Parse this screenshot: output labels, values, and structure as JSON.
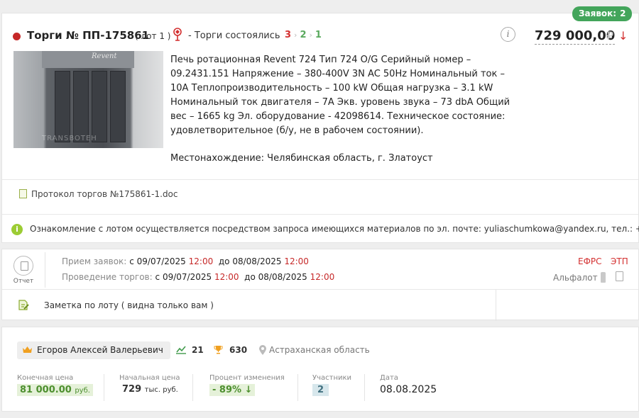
{
  "bids_badge": {
    "label": "Заявок:",
    "count": "2"
  },
  "header": {
    "title": "Торги № ПП-175861",
    "lot": "( лот 1 )",
    "status": "- Торги состоялись",
    "steps": [
      "3",
      "2",
      "1"
    ],
    "price": "729 000,00",
    "currency": "₽",
    "price_trend": "↓",
    "status_color": "#c62828"
  },
  "lot": {
    "photo_brand": "Revent",
    "photo_watermark": "TRANSBOTEH",
    "description": "Печь ротационная Revent 724 Тип 724 O/G Серийный номер – 09.2431.151 Напряжение – 380-400V 3N AC 50Hz Номинальный ток – 10A Теплопроизводительность – 100 kW Общая нагрузка – 3.1 kW Номинальный ток двигателя – 7А Экв. уровень звука – 73 dbA Общий вес – 1665 kg Эл. оборудование - 42098614. Техническое состояние: удовлетворительное (б/у, не в рабочем состоянии).",
    "location": "Местонахождение: Челябинская область, г. Златоуст"
  },
  "document": {
    "name": "Протокол торгов №175861-1.doc"
  },
  "notice": {
    "text": "Ознакомление с лотом осуществляется посредством запроса имеющихся материалов по эл. почте: yuliaschumkowa@yandex.ru, тел.: +…"
  },
  "schedule": {
    "report_label": "Отчет",
    "bids": {
      "label": "Прием заявок:",
      "from_word": "с",
      "from_date": "09/07/2025",
      "from_time": "12:00",
      "to_word": "до",
      "to_date": "08/08/2025",
      "to_time": "12:00"
    },
    "auction": {
      "label": "Проведение торгов:",
      "from_word": "с",
      "from_date": "09/07/2025",
      "from_time": "12:00",
      "to_word": "до",
      "to_date": "08/08/2025",
      "to_time": "12:00"
    },
    "efrs": "ЕФРС",
    "etp": "ЭТП",
    "platform": "Альфалот"
  },
  "note": {
    "text": "Заметка по лоту ( видна только вам )"
  },
  "winner": {
    "name": "Егоров Алексей Валерьевич",
    "rating": "21",
    "wins": "630",
    "region": "Астраханская область"
  },
  "metrics": {
    "final_price": {
      "label": "Конечная цена",
      "value": "81 000.00",
      "unit": "руб."
    },
    "start_price": {
      "label": "Начальная цена",
      "value": "729",
      "unit": "тыс. руб."
    },
    "change": {
      "label": "Процент изменения",
      "value": "- 89%",
      "arrow": "↓"
    },
    "participants": {
      "label": "Участники",
      "value": "2"
    },
    "date": {
      "label": "Дата",
      "value": "08.08.2025"
    }
  }
}
